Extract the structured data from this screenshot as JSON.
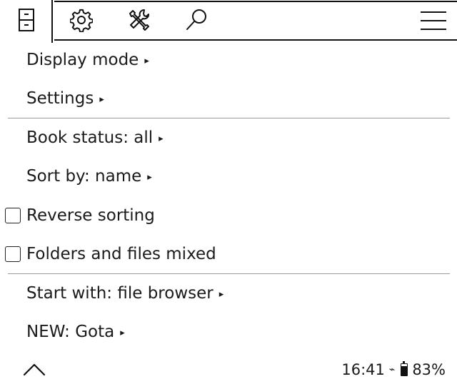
{
  "toolbar": {
    "icons": [
      "file-cabinet-icon",
      "gear-icon",
      "tools-icon",
      "search-icon",
      "hamburger-menu-icon"
    ]
  },
  "menu": {
    "display_mode": "Display mode",
    "settings": "Settings",
    "book_status": "Book status: all",
    "sort_by": "Sort by: name",
    "reverse_sorting": {
      "label": "Reverse sorting",
      "checked": false
    },
    "folders_files_mixed": {
      "label": "Folders and files mixed",
      "checked": false
    },
    "start_with": "Start with: file browser",
    "new_gota": "NEW: Gota",
    "submenu_arrow": "▸"
  },
  "footer": {
    "up_icon": "chevron-up-icon",
    "time": "16:41",
    "connection_icon": "connection-icon",
    "battery_icon": "battery-icon",
    "battery_percent": "83%",
    "battery_level": 0.83
  }
}
